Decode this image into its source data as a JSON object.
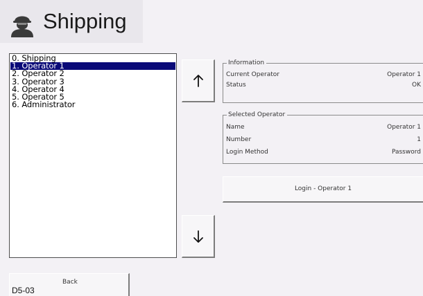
{
  "header": {
    "title": "Shipping",
    "icon": "operator-icon"
  },
  "operator_list": {
    "items": [
      {
        "label": "0. Shipping",
        "selected": false
      },
      {
        "label": "1. Operator 1",
        "selected": true
      },
      {
        "label": "2. Operator 2",
        "selected": false
      },
      {
        "label": "3. Operator 3",
        "selected": false
      },
      {
        "label": "4. Operator 4",
        "selected": false
      },
      {
        "label": "5. Operator 5",
        "selected": false
      },
      {
        "label": "6. Administrator",
        "selected": false
      }
    ]
  },
  "information": {
    "title": "Information",
    "rows": [
      {
        "label": "Current Operator",
        "value": "Operator 1"
      },
      {
        "label": "Status",
        "value": "OK"
      }
    ]
  },
  "selected_operator": {
    "title": "Selected Operator",
    "rows": [
      {
        "label": "Name",
        "value": "Operator 1"
      },
      {
        "label": "Number",
        "value": "1"
      },
      {
        "label": "Login Method",
        "value": "Password"
      }
    ]
  },
  "buttons": {
    "login_label": "Login - Operator 1",
    "back_label": "Back",
    "up_icon": "arrow-up-icon",
    "down_icon": "arrow-down-icon"
  },
  "footer": {
    "screen_code": "D5-03"
  },
  "colors": {
    "selection_bg": "#0a0a78",
    "selection_fg": "#ffffff",
    "background": "#f3f1f5"
  }
}
